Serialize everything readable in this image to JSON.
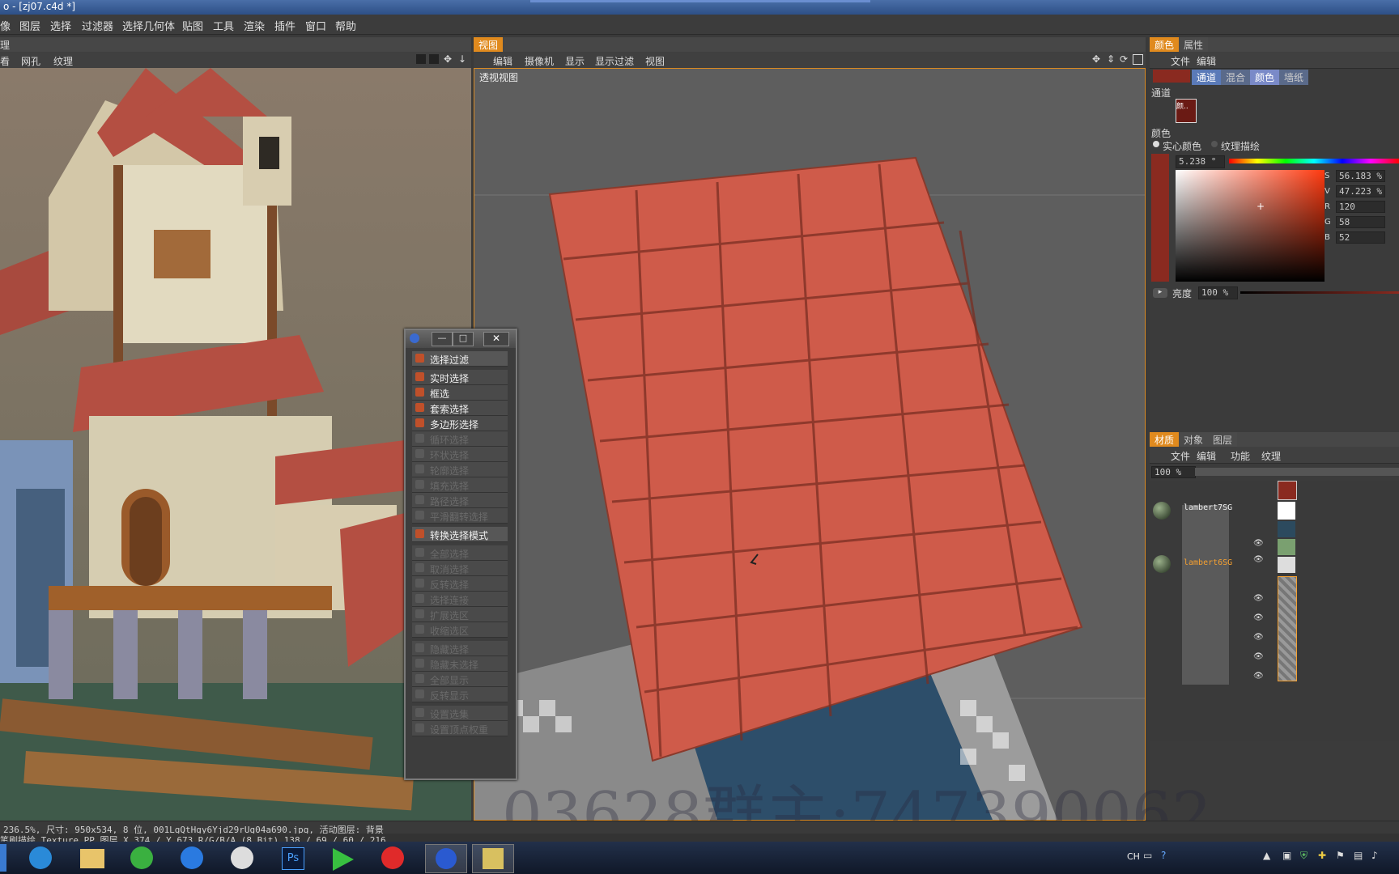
{
  "window": {
    "title": "o - [zj07.c4d *]"
  },
  "menu": [
    "像",
    "图层",
    "选择",
    "过滤器",
    "选择几何体",
    "贴图",
    "工具",
    "渲染",
    "插件",
    "窗口",
    "帮助"
  ],
  "left_panel": {
    "header": "理",
    "sub_items": [
      "看",
      "网孔",
      "纹理"
    ]
  },
  "viewport": {
    "tab": "视图",
    "sub_items": [
      "编辑",
      "摄像机",
      "显示",
      "显示过滤",
      "视图"
    ],
    "label": "透视视图"
  },
  "float_window": {
    "items": [
      {
        "label": "选择过滤",
        "enabled": true,
        "header": true
      },
      {
        "label": "实时选择",
        "enabled": true
      },
      {
        "label": "框选",
        "enabled": true
      },
      {
        "label": "套索选择",
        "enabled": true
      },
      {
        "label": "多边形选择",
        "enabled": true
      },
      {
        "label": "循环选择",
        "enabled": false
      },
      {
        "label": "环状选择",
        "enabled": false
      },
      {
        "label": "轮廓选择",
        "enabled": false
      },
      {
        "label": "填充选择",
        "enabled": false
      },
      {
        "label": "路径选择",
        "enabled": false
      },
      {
        "label": "平滑翻转选择",
        "enabled": false
      },
      {
        "label": "转换选择模式",
        "enabled": true,
        "header": true
      },
      {
        "label": "全部选择",
        "enabled": false
      },
      {
        "label": "取消选择",
        "enabled": false
      },
      {
        "label": "反转选择",
        "enabled": false
      },
      {
        "label": "选择连接",
        "enabled": false
      },
      {
        "label": "扩展选区",
        "enabled": false
      },
      {
        "label": "收缩选区",
        "enabled": false
      },
      {
        "label": "隐藏选择",
        "enabled": false
      },
      {
        "label": "隐藏未选择",
        "enabled": false
      },
      {
        "label": "全部显示",
        "enabled": false
      },
      {
        "label": "反转显示",
        "enabled": false
      },
      {
        "label": "设置选集",
        "enabled": false
      },
      {
        "label": "设置顶点权重",
        "enabled": false
      }
    ]
  },
  "color_panel": {
    "tabs": [
      "颜色",
      "属性"
    ],
    "sub_items": [
      "文件",
      "编辑"
    ],
    "mode_tabs": [
      "通道",
      "混合",
      "颜色",
      "墙纸"
    ],
    "channel_label": "通道",
    "swatch_label": "颜..",
    "color_label": "颜色",
    "radio_solid": "实心颜色",
    "radio_texture": "纹理描绘",
    "hue_value": "5.238 °",
    "fields": [
      {
        "key": "S",
        "value": "56.183 %"
      },
      {
        "key": "V",
        "value": "47.223 %"
      },
      {
        "key": "R",
        "value": "120"
      },
      {
        "key": "G",
        "value": "58"
      },
      {
        "key": "B",
        "value": "52"
      }
    ],
    "brightness_label": "亮度",
    "brightness_value": "100 %",
    "accent": "#e08a1e"
  },
  "material_panel": {
    "tabs": [
      "材质",
      "对象",
      "图层"
    ],
    "sub_items": [
      "文件",
      "编辑",
      "功能",
      "纹理"
    ],
    "zoom": "100 %",
    "materials": [
      {
        "name": "lambert7SG",
        "highlight": false
      },
      {
        "name": "lambert6SG",
        "highlight": true
      }
    ]
  },
  "status": {
    "line1": "236.5%, 尺寸: 950x534, 8 位, 001LgQtHgy6Yjd29rUg04a690.jpg, 活动图层: 背景",
    "line2": "笔刷描绘  Texture PP 图层   X 374 / Y 673 R/G/B/A (8 Bit) 138 / 69 / 60 / 216"
  },
  "watermark": "03628群主:747390062",
  "taskbar": {
    "icons": [
      "windows-logo-icon",
      "ie-icon",
      "explorer-icon",
      "360-icon",
      "baidu-icon",
      "panda-icon",
      "photoshop-icon",
      "player-icon",
      "media-icon",
      "c4d-icon",
      "bodypaint-icon"
    ],
    "tray_text": "CH"
  }
}
